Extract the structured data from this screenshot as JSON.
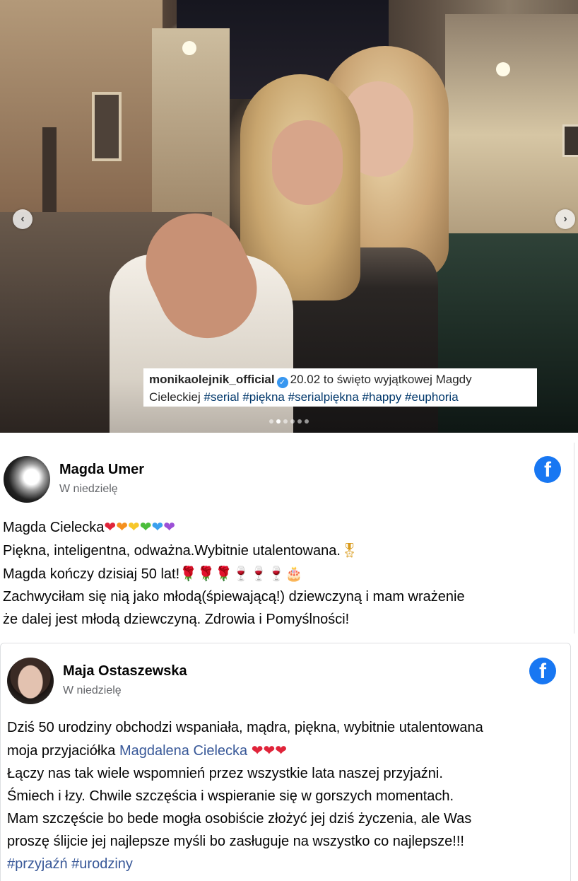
{
  "instagram": {
    "username": "monikaolejnik_official",
    "caption_text": "20.02 to święto wyjątkowej Magdy",
    "caption_line2": "Cieleckiej",
    "hashtags": [
      "#serial",
      "#piękna",
      "#serialpiękna",
      "#happy",
      "#euphoria"
    ],
    "carousel_count": 6,
    "carousel_active": 2,
    "prev_icon": "chevron-left-icon",
    "next_icon": "chevron-right-icon"
  },
  "post1": {
    "author": "Magda Umer",
    "time": "W niedzielę",
    "network_icon": "facebook-icon",
    "line1_text": "Magda Cielecka",
    "line1_emojis": [
      "❤",
      "❤",
      "❤",
      "❤",
      "❤",
      "❤"
    ],
    "line2_text": "Piękna, inteligentna, odważna.Wybitnie utalentowana.",
    "line2_emoji": "🎖",
    "line3_text": "Magda kończy dzisiaj 50 lat!",
    "line3_emojis": [
      "🌹",
      "🌹",
      "🌹",
      "🍷",
      "🍷",
      "🍷",
      "🎂"
    ],
    "line4_text": "Zachwyciłam się nią jako młodą(śpiewającą!) dziewczyną i mam wrażenie",
    "line5_text": "że dalej jest młodą dziewczyną. Zdrowia i Pomyślności!"
  },
  "post2": {
    "author": "Maja Ostaszewska",
    "time": "W niedzielę",
    "network_icon": "facebook-icon",
    "line1_text": "Dziś 50 urodziny obchodzi wspaniała, mądra, piękna, wybitnie utalentowana",
    "line2_text": "moja przyjaciółka ",
    "line2_link": "Magdalena Cielecka",
    "line2_emojis": [
      "❤",
      "❤",
      "❤"
    ],
    "line3_text": "Łączy nas tak wiele wspomnień przez wszystkie lata naszej przyjaźni.",
    "line4_text": "Śmiech i łzy. Chwile szczęścia i wspieranie się w gorszych momentach.",
    "line5_text": "Mam szczęście bo bede mogła osobiście złożyć jej dziś życzenia, ale Was",
    "line6_text": "proszę ślijcie jej najlepsze myśli bo zasługuje na wszystko co najlepsze!!!",
    "hashtags": [
      "#przyjaźń",
      "#urodziny"
    ]
  },
  "colors": {
    "facebook_blue": "#1877f2",
    "link": "#385898",
    "instagram_tag": "#00376b",
    "muted": "#65676b"
  }
}
